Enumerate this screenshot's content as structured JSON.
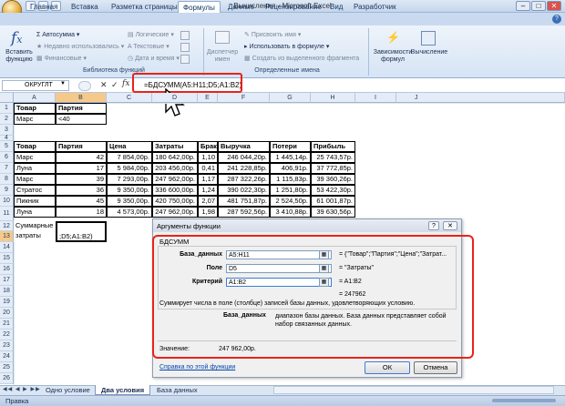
{
  "window": {
    "title": "Вычисления - Microsoft Excel"
  },
  "ribbon_tabs": [
    "Главная",
    "Вставка",
    "Разметка страницы",
    "Формулы",
    "Данные",
    "Рецензирование",
    "Вид",
    "Разработчик"
  ],
  "ribbon": {
    "insert_function": "Вставить функцию",
    "autosum": "Автосумма",
    "recently_used": "Недавно использовались",
    "financial": "Финансовые",
    "logical": "Логические",
    "text": "Текстовые",
    "datetime": "Дата и время",
    "library_label": "Библиотека функций",
    "name_manager": "Диспетчер имен",
    "assign_name": "Присвоить имя",
    "use_in_formula": "Использовать в формуле",
    "create_from_selection": "Создать из выделенного фрагмента",
    "names_label": "Определенные имена",
    "dependencies": "Зависимости формул",
    "calculation": "Вычисление"
  },
  "formula_bar": {
    "name_box": "ОКРУГЛТ",
    "cancel": "✕",
    "enter": "✓",
    "fx": "fx",
    "formula": "=БДСУММ(A5:H11;D5;A1:B2)"
  },
  "columns": [
    "A",
    "B",
    "C",
    "D",
    "E",
    "F",
    "G",
    "H",
    "I",
    "J"
  ],
  "criteria": {
    "header": [
      "Товар",
      "Партия"
    ],
    "row": [
      "Марс",
      "<40"
    ]
  },
  "table": {
    "headers": [
      "Товар",
      "Партия",
      "Цена",
      "Затраты",
      "Брак",
      "Выручка",
      "Потери",
      "Прибыль"
    ],
    "rows": [
      [
        "Марс",
        "42",
        "7 854,00р.",
        "180 642,00р.",
        "1,10",
        "246 044,20р.",
        "1 445,14р.",
        "25 743,57р."
      ],
      [
        "Луна",
        "17",
        "5 984,00р.",
        "203 456,00р.",
        "0,41",
        "241 228,85р.",
        "406,91р.",
        "37 772,85р."
      ],
      [
        "Марс",
        "39",
        "7 293,00р.",
        "247 962,00р.",
        "1,17",
        "287 322,26р.",
        "1 115,83р.",
        "39 360,26р."
      ],
      [
        "Стратос",
        "36",
        "9 350,00р.",
        "336 600,00р.",
        "1,24",
        "390 022,30р.",
        "1 251,80р.",
        "53 422,30р."
      ],
      [
        "Пикник",
        "45",
        "9 350,00р.",
        "420 750,00р.",
        "2,07",
        "481 751,87р.",
        "2 524,50р.",
        "61 001,87р."
      ],
      [
        "Луна",
        "18",
        "4 573,00р.",
        "247 962,00р.",
        "1,98",
        "287 592,56р.",
        "3 410,88р.",
        "39 630,56р."
      ]
    ]
  },
  "sum_cell": {
    "label_line1": "Суммарные",
    "label_line2": "затраты",
    "value": ";D5;A1:B2)"
  },
  "dialog": {
    "title": "Аргументы функции",
    "help_btn": "?",
    "close_btn": "✕",
    "func_name": "БДСУММ",
    "args": [
      {
        "label": "База_данных",
        "value": "A5:H11",
        "result": "= {\"Товар\";\"Партия\";\"Цена\";\"Затрат..."
      },
      {
        "label": "Поле",
        "value": "D5",
        "result": "= \"Затраты\""
      },
      {
        "label": "Критерий",
        "value": "A1:B2",
        "result": "= A1:B2"
      }
    ],
    "total_result": "= 247962",
    "description": "Суммирует числа в поле (столбце) записей базы данных, удовлетворяющих условию.",
    "arg_help_label": "База_данных",
    "arg_help_text": "диапазон базы данных. База данных представляет собой набор связанных данных.",
    "value_label": "Значение:",
    "value": "247 962,00р.",
    "help_link": "Справка по этой функции",
    "ok": "ОК",
    "cancel": "Отмена"
  },
  "sheet_tabs": [
    "Одно условие",
    "Два условия",
    "База данных"
  ],
  "status": "Правка",
  "colors": {
    "highlight": "#e8231a",
    "accent": "#2a5699"
  }
}
